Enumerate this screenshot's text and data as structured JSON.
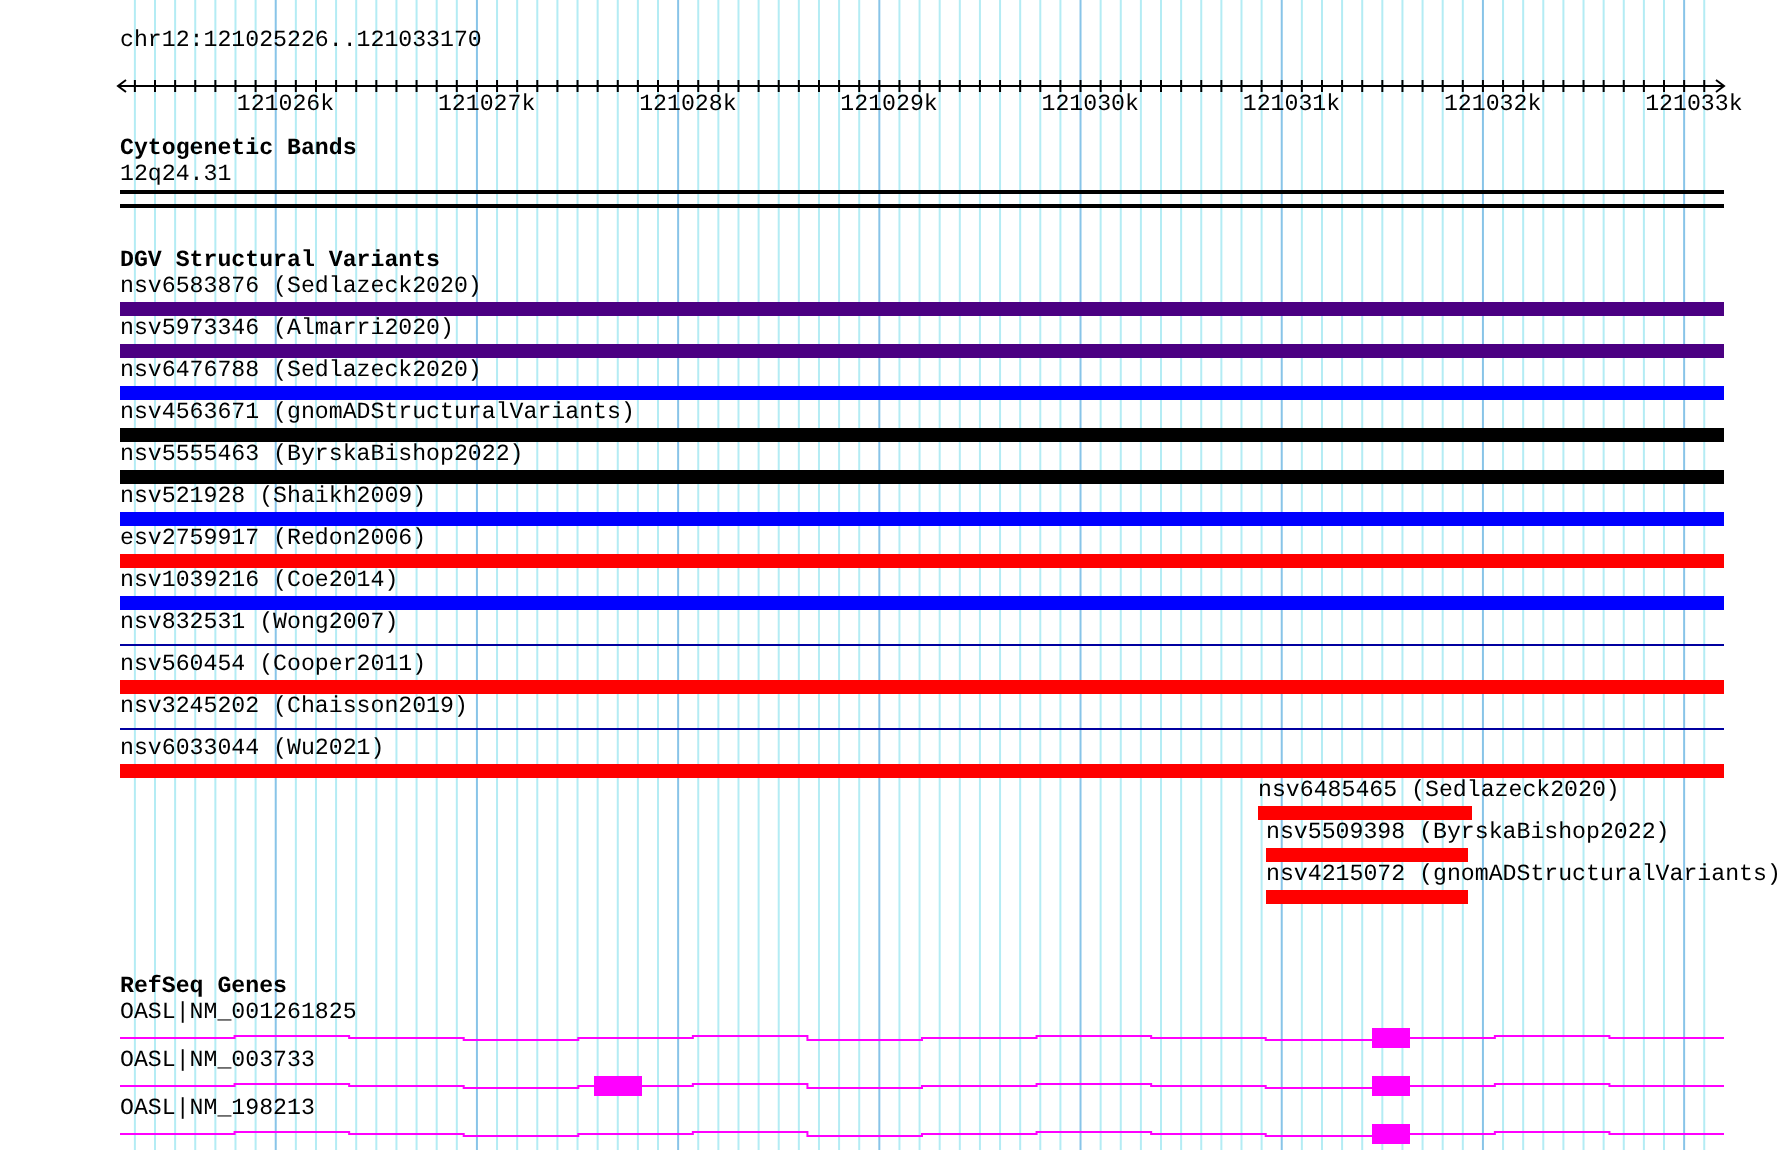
{
  "ruler": {
    "location": "chr12:121025226..121033170",
    "ticks": [
      "121026k",
      "121027k",
      "121028k",
      "121029k",
      "121030k",
      "121031k",
      "121032k",
      "121033k"
    ]
  },
  "cytogenetic_bands": {
    "title": "Cytogenetic Bands",
    "features": [
      {
        "label": "12q24.31"
      }
    ]
  },
  "dgv_structural_variants": {
    "title": "DGV Structural Variants",
    "features": [
      {
        "label": "nsv6583876 (Sedlazeck2020)",
        "kind": "full",
        "color": "#4b0082"
      },
      {
        "label": "nsv5973346 (Almarri2020)",
        "kind": "full",
        "color": "#4b0082"
      },
      {
        "label": "nsv6476788 (Sedlazeck2020)",
        "kind": "full",
        "color": "#0000ff"
      },
      {
        "label": "nsv4563671 (gnomADStructuralVariants)",
        "kind": "full",
        "color": "#000000"
      },
      {
        "label": "nsv5555463 (ByrskaBishop2022)",
        "kind": "full",
        "color": "#000000"
      },
      {
        "label": "nsv521928 (Shaikh2009)",
        "kind": "full",
        "color": "#0000ff"
      },
      {
        "label": "esv2759917 (Redon2006)",
        "kind": "full",
        "color": "#ff0000"
      },
      {
        "label": "nsv1039216 (Coe2014)",
        "kind": "full",
        "color": "#0000ff"
      },
      {
        "label": "nsv832531 (Wong2007)",
        "kind": "thin",
        "color": "#0000a0"
      },
      {
        "label": "nsv560454 (Cooper2011)",
        "kind": "full",
        "color": "#ff0000"
      },
      {
        "label": "nsv3245202 (Chaisson2019)",
        "kind": "thin",
        "color": "#0000a0"
      },
      {
        "label": "nsv6033044 (Wu2021)",
        "kind": "full",
        "color": "#ff0000"
      },
      {
        "label": "nsv6485465 (Sedlazeck2020)",
        "kind": "partial",
        "color": "#ff0000"
      },
      {
        "label": "nsv5509398 (ByrskaBishop2022)",
        "kind": "partial",
        "color": "#ff0000"
      },
      {
        "label": "nsv4215072 (gnomADStructuralVariants)",
        "kind": "partial",
        "color": "#ff0000"
      }
    ]
  },
  "refseq_genes": {
    "title": "RefSeq Genes",
    "features": [
      {
        "label": "OASL|NM_001261825",
        "kind": "one_exon"
      },
      {
        "label": "OASL|NM_003733",
        "kind": "two_exons"
      },
      {
        "label": "OASL|NM_198213",
        "kind": "one_exon"
      }
    ]
  }
}
